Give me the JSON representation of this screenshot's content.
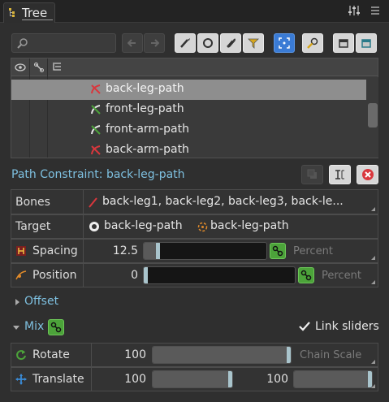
{
  "tab": {
    "label": "Tree"
  },
  "search": {
    "placeholder": ""
  },
  "tree": {
    "rows": [
      {
        "label": "back-leg-path",
        "icon": "path-red-icon",
        "selected": true
      },
      {
        "label": "front-leg-path",
        "icon": "path-green-icon",
        "selected": false
      },
      {
        "label": "front-arm-path",
        "icon": "path-green-icon",
        "selected": false
      },
      {
        "label": "back-arm-path",
        "icon": "path-red-icon",
        "selected": false
      }
    ]
  },
  "constraint": {
    "title": "Path Constraint: back-leg-path"
  },
  "props": {
    "bones": {
      "label": "Bones",
      "value": "back-leg1, back-leg2, back-leg3, back-le..."
    },
    "target": {
      "label": "Target",
      "value1": "back-leg-path",
      "value2": "back-leg-path"
    },
    "spacing": {
      "label": "Spacing",
      "value": "12.5",
      "mode": "Percent",
      "level": 0.1
    },
    "position": {
      "label": "Position",
      "value": "0",
      "mode": "Percent",
      "level": 0.0
    }
  },
  "offset": {
    "label": "Offset"
  },
  "mix": {
    "label": "Mix",
    "link_sliders": "Link sliders",
    "rotate": {
      "label": "Rotate",
      "value": "100",
      "mode": "Chain Scale",
      "level": 1.0
    },
    "translate": {
      "label": "Translate",
      "value_x": "100",
      "value_y": "100",
      "level_x": 1.0,
      "level_y": 1.0
    }
  },
  "colors": {
    "accent": "#7ec0e0",
    "green": "#4ca33a",
    "red": "#d9373d",
    "blue": "#3a7bd5"
  }
}
